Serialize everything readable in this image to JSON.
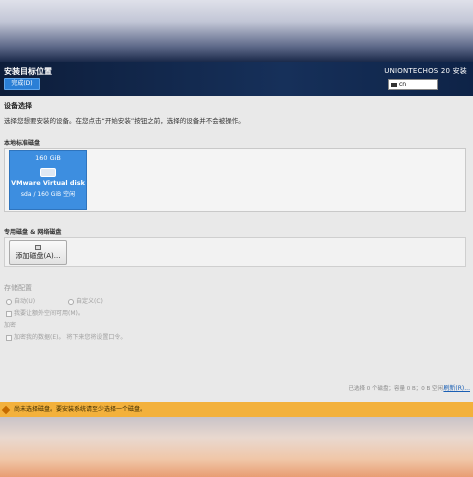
{
  "header": {
    "title": "安装目标位置",
    "done_button": "完成(D)",
    "product": "UNIONTECHOS 20 安装",
    "keyboard_layout": "cn"
  },
  "main": {
    "section_title": "设备选择",
    "description": "选择您想要安装的设备。在您点击“开始安装”按钮之前，选择的设备并不会被操作。",
    "local_disks_label": "本地标准磁盘",
    "disk": {
      "size": "160 GiB",
      "name": "VMware Virtual disk",
      "info": "sda  /  160 GiB 空闲"
    },
    "special_disks_label": "专用磁盘 & 网络磁盘",
    "add_disk_button": "添加磁盘(A)...",
    "storage_config_label": "存储配置",
    "storage_options": {
      "auto": "自动(U)",
      "custom": "自定义(C)"
    },
    "extra_space_option": "我要让额外空间可用(M)。",
    "encryption_label": "加密",
    "encrypt_option": "加密我的数据(E)。  将下来您将设置口令。",
    "summary": "已选择 0 个磁盘；容量 0 B；0 B 空闲",
    "refresh_link": "刷新(R)..."
  },
  "warning": {
    "text": "尚未选择磁盘。要安装系统请至少选择一个磁盘。"
  }
}
